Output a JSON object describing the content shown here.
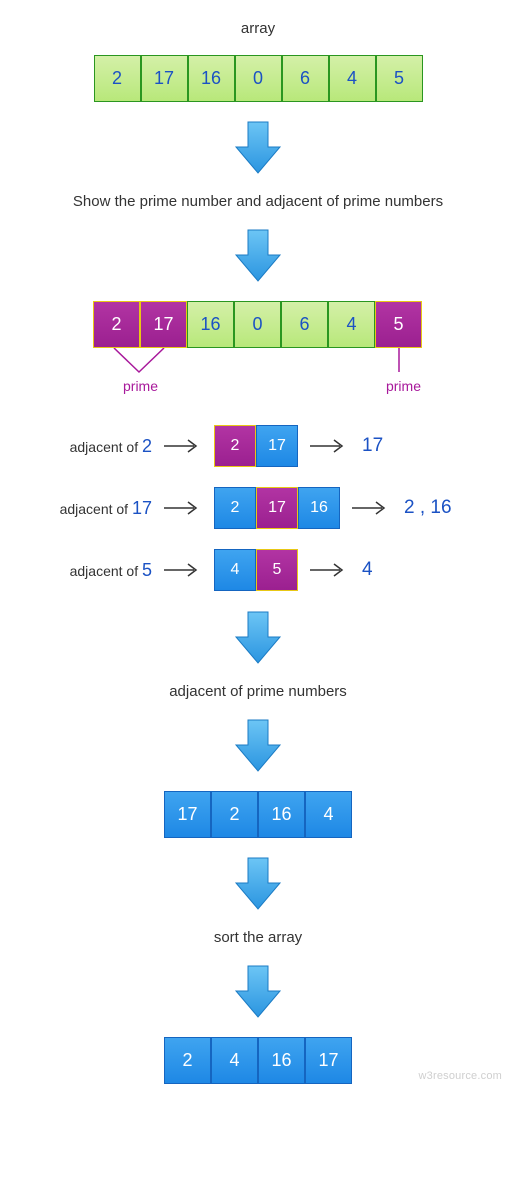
{
  "title": "array",
  "array": [
    "2",
    "17",
    "16",
    "0",
    "6",
    "4",
    "5"
  ],
  "step1_text": "Show the prime number and adjacent of prime numbers",
  "highlighted_array_classes": [
    "magenta",
    "magenta",
    "green",
    "green",
    "green",
    "green",
    "magenta"
  ],
  "prime_label": "prime",
  "adjacent_rows": [
    {
      "label_prefix": "adjacent of",
      "number": "2",
      "cells": [
        {
          "v": "2",
          "c": "magenta"
        },
        {
          "v": "17",
          "c": "blue"
        }
      ],
      "result": "17"
    },
    {
      "label_prefix": "adjacent of",
      "number": "17",
      "cells": [
        {
          "v": "2",
          "c": "blue"
        },
        {
          "v": "17",
          "c": "magenta"
        },
        {
          "v": "16",
          "c": "blue"
        }
      ],
      "result": "2 ,  16"
    },
    {
      "label_prefix": "adjacent of",
      "number": "5",
      "cells": [
        {
          "v": "4",
          "c": "blue"
        },
        {
          "v": "5",
          "c": "magenta"
        }
      ],
      "result": "4"
    }
  ],
  "step2_text": "adjacent of prime numbers",
  "adjacent_array": [
    "17",
    "2",
    "16",
    "4"
  ],
  "step3_text": "sort the array",
  "sorted_array": [
    "2",
    "4",
    "16",
    "17"
  ],
  "watermark": "w3resource.com"
}
